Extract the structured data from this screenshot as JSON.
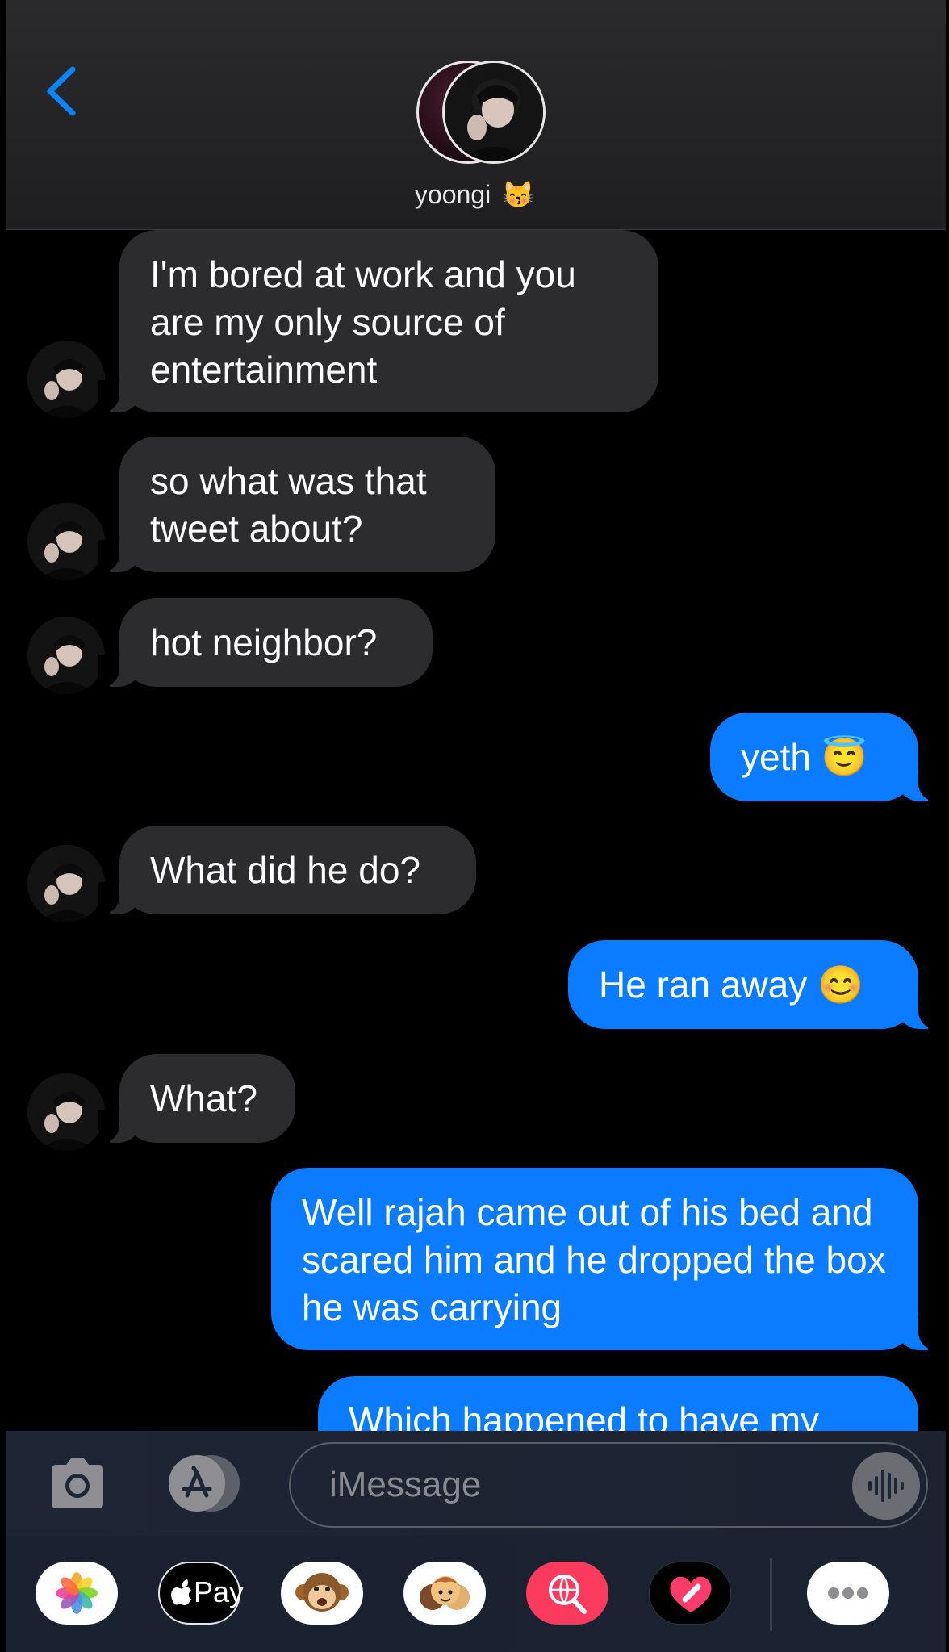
{
  "header": {
    "back_label": "Back",
    "contact_name": "yoongi",
    "contact_emoji": "😽"
  },
  "messages": [
    {
      "direction": "incoming",
      "text": "I'm bored at work and you are my only source of entertainment"
    },
    {
      "direction": "incoming",
      "text": "so what was that tweet about?"
    },
    {
      "direction": "incoming",
      "text": "hot neighbor?"
    },
    {
      "direction": "outgoing",
      "text": "yeth 😇"
    },
    {
      "direction": "incoming",
      "text": "What did he do?"
    },
    {
      "direction": "outgoing",
      "text": "He ran away 😊"
    },
    {
      "direction": "incoming",
      "text": "What?"
    },
    {
      "direction": "outgoing",
      "text": "Well rajah came out of his bed and scared him and he dropped the box he was carrying"
    },
    {
      "direction": "outgoing",
      "text": "Which happened to have my"
    }
  ],
  "input": {
    "placeholder": "iMessage"
  },
  "apps": {
    "applepay_label": "Pay",
    "items": [
      "photos-app",
      "applepay-app",
      "animoji-app",
      "memoji-app",
      "images-search-app",
      "digital-touch-app",
      "more-apps"
    ]
  },
  "colors": {
    "incoming_bubble": "#2c2c2e",
    "outgoing_bubble": "#0b7cff",
    "accent": "#0b84ff"
  }
}
